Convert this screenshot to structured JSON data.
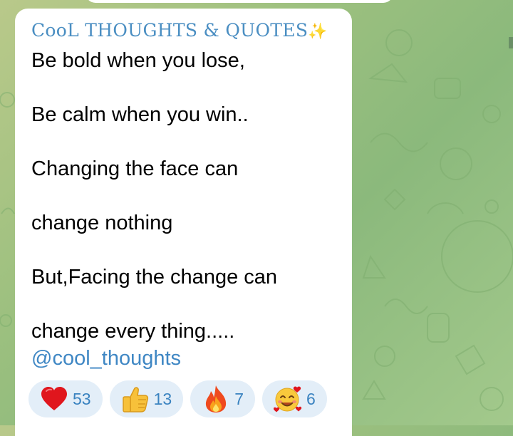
{
  "channel": {
    "name": "CooL THOUGHTS & QUOTES",
    "name_sparkle": "✨"
  },
  "message": {
    "lines": [
      "Be bold when you lose,",
      "Be calm when you win..",
      "Changing the face can",
      "change nothing",
      "But,Facing the change can",
      "change every thing....."
    ],
    "mention": "@cool_thoughts"
  },
  "reactions": [
    {
      "icon": "red-heart-icon",
      "count": "53"
    },
    {
      "icon": "thumbs-up-icon",
      "count": "13"
    },
    {
      "icon": "fire-icon",
      "count": "7"
    },
    {
      "icon": "smiling-face-with-hearts-icon",
      "count": "6"
    }
  ],
  "colors": {
    "channel_name": "#4a8ec2",
    "mention": "#3f87c4",
    "reaction_bg": "#e3eef8",
    "reaction_count": "#3a83c0",
    "bubble": "#ffffff"
  }
}
